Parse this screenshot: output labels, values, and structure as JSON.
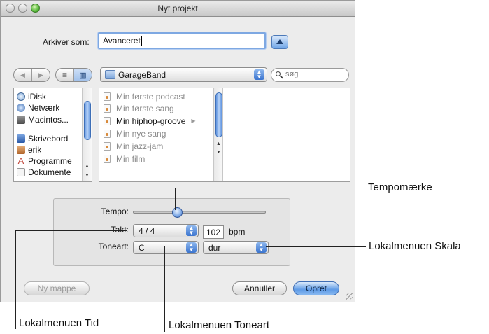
{
  "window": {
    "title": "Nyt projekt"
  },
  "save_as": {
    "label": "Arkiver som:",
    "value": "Avanceret"
  },
  "location": {
    "selected": "GarageBand",
    "search_placeholder": "søg"
  },
  "sidebar": {
    "items": [
      {
        "label": "iDisk",
        "icon": "idisk-icon"
      },
      {
        "label": "Netværk",
        "icon": "network-icon"
      },
      {
        "label": "Macintos...",
        "icon": "hard-drive-icon"
      },
      {
        "label": "Skrivebord",
        "icon": "desktop-icon"
      },
      {
        "label": "erik",
        "icon": "home-icon"
      },
      {
        "label": "Programme",
        "icon": "applications-icon"
      },
      {
        "label": "Dokumente",
        "icon": "documents-icon"
      }
    ]
  },
  "files": {
    "items": [
      {
        "label": "Min første podcast",
        "enabled": false
      },
      {
        "label": "Min første sang",
        "enabled": false
      },
      {
        "label": "Min hiphop-groove",
        "enabled": true
      },
      {
        "label": "Min nye sang",
        "enabled": false
      },
      {
        "label": "Min jazz-jam",
        "enabled": false
      },
      {
        "label": "Min film",
        "enabled": false
      }
    ]
  },
  "options": {
    "tempo_label": "Tempo:",
    "tempo_slider_fraction": 0.33,
    "time_label": "Takt:",
    "time_value": "4 / 4",
    "tempo_value": "102",
    "tempo_unit": "bpm",
    "key_label": "Toneart:",
    "key_value": "C",
    "scale_value": "dur"
  },
  "buttons": {
    "new_folder": "Ny mappe",
    "cancel": "Annuller",
    "create": "Opret"
  },
  "callouts": {
    "tempo_marker": "Tempomærke",
    "scale_menu": "Lokalmenuen Skala",
    "time_menu": "Lokalmenuen Tid",
    "key_menu": "Lokalmenuen Toneart"
  }
}
